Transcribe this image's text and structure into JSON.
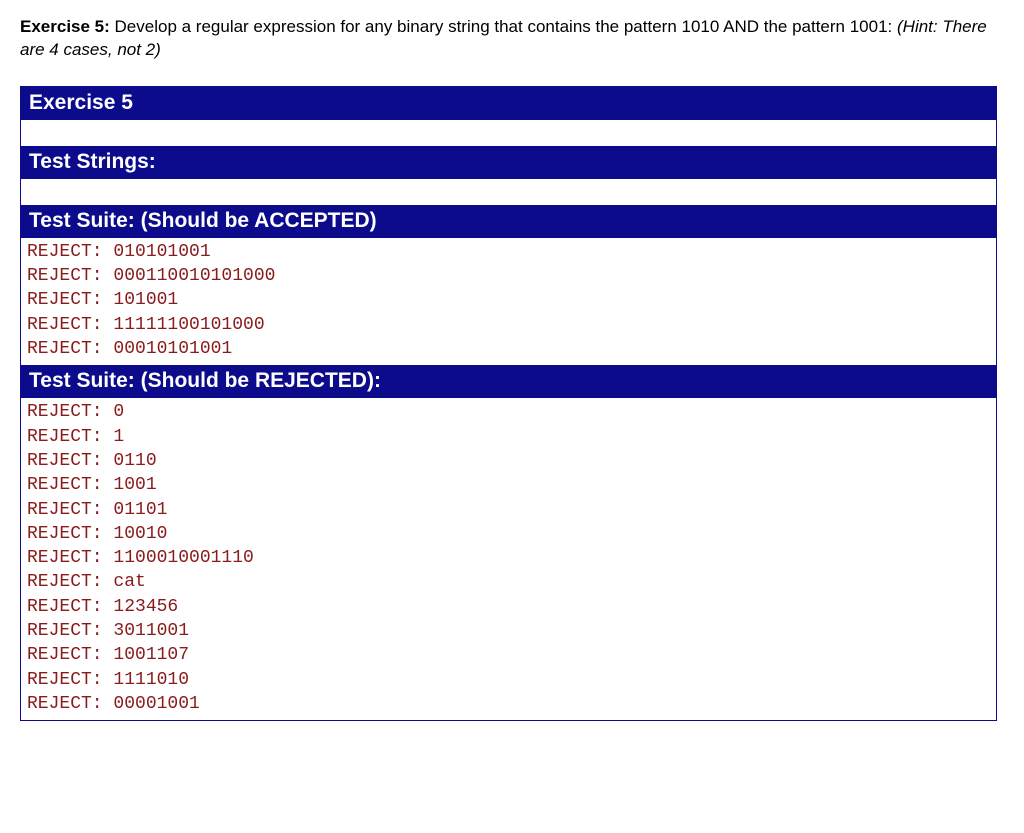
{
  "problem": {
    "label": "Exercise 5:",
    "text_part1": " Develop a regular expression for any binary string that contains the pattern 1010 AND the pattern 1001: ",
    "hint": "(Hint: There are 4 cases, not 2)"
  },
  "sections": {
    "title": "Exercise 5",
    "test_strings": "Test Strings:",
    "accepted_header": "Test Suite: (Should be ACCEPTED)",
    "rejected_header": "Test Suite: (Should be REJECTED):"
  },
  "accepted": [
    {
      "status": "REJECT",
      "value": "010101001"
    },
    {
      "status": "REJECT",
      "value": "000110010101000"
    },
    {
      "status": "REJECT",
      "value": "101001"
    },
    {
      "status": "REJECT",
      "value": "11111100101000"
    },
    {
      "status": "REJECT",
      "value": "00010101001"
    }
  ],
  "rejected": [
    {
      "status": "REJECT",
      "value": "0"
    },
    {
      "status": "REJECT",
      "value": "1"
    },
    {
      "status": "REJECT",
      "value": "0110"
    },
    {
      "status": "REJECT",
      "value": "1001"
    },
    {
      "status": "REJECT",
      "value": "01101"
    },
    {
      "status": "REJECT",
      "value": "10010"
    },
    {
      "status": "REJECT",
      "value": "1100010001110"
    },
    {
      "status": "REJECT",
      "value": "cat"
    },
    {
      "status": "REJECT",
      "value": "123456"
    },
    {
      "status": "REJECT",
      "value": "3011001"
    },
    {
      "status": "REJECT",
      "value": "1001107"
    },
    {
      "status": "REJECT",
      "value": "1111010"
    },
    {
      "status": "REJECT",
      "value": "00001001"
    }
  ],
  "colors": {
    "header_bg": "#0b0b8c",
    "reject_text": "#8a1b1b"
  }
}
